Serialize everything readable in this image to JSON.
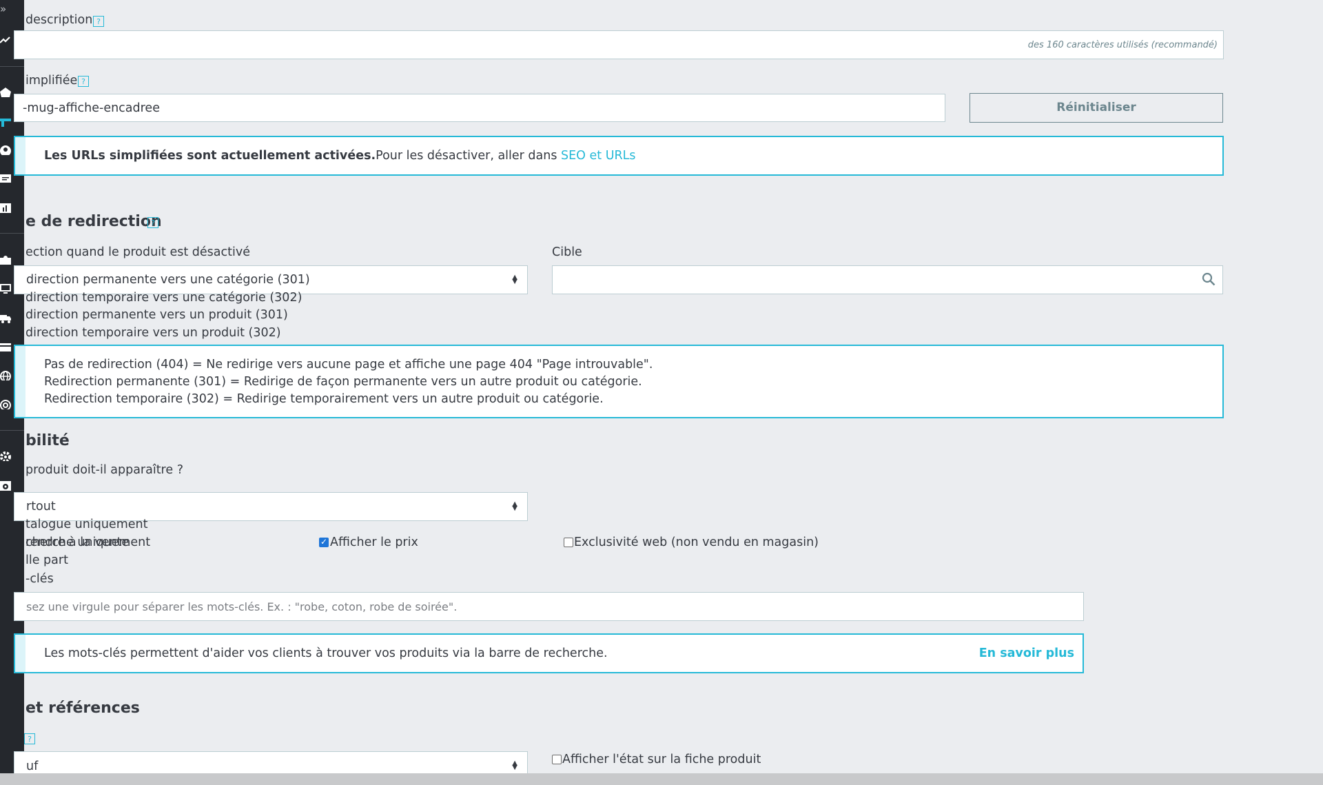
{
  "sidebar": {
    "icons": [
      "expand-icon",
      "stats-icon",
      "orders-icon",
      "catalog-icon",
      "customers-icon",
      "messages-icon",
      "reports-icon",
      "modules-icon",
      "design-icon",
      "shipping-icon",
      "payment-icon",
      "international-icon",
      "advanced-icon",
      "settings-icon",
      "config-icon"
    ],
    "expand_glyph": "»"
  },
  "meta_description": {
    "label": "description",
    "help": "?",
    "counter": "des 160 caractères utilisés (recommandé)"
  },
  "friendly_url": {
    "label": "implifiée",
    "help": "?",
    "value": "-mug-affiche-encadree",
    "reset_label": "Réinitialiser",
    "info_bold": "Les URLs simplifiées sont actuellement activées.",
    "info_text": "Pour les désactiver, aller dans ",
    "info_link": "SEO et URLs"
  },
  "redirection": {
    "title": "e de redirection",
    "help": "?",
    "when_label": "ection quand le produit est désactivé",
    "selected": "direction permanente vers une catégorie (301)",
    "options": [
      "direction temporaire vers une catégorie (302)",
      "direction permanente vers un produit (301)",
      "direction temporaire vers un produit (302)"
    ],
    "target_label": "Cible",
    "info_lines": [
      "Pas de redirection (404) = Ne redirige vers aucune page et affiche une page 404 \"Page introuvable\".",
      "Redirection permanente (301) = Redirige de façon permanente vers un autre produit ou catégorie.",
      "Redirection temporaire (302) = Redirige temporairement vers un autre produit ou catégorie."
    ]
  },
  "visibility": {
    "title": "bilité",
    "question": "produit doit-il apparaître ?",
    "selected": "rtout",
    "options": [
      "talogue uniquement",
      "cherche uniquement",
      "lle part"
    ],
    "overlap_text": "rendre à la vente",
    "show_price_label": "Afficher le prix",
    "show_price_checked": true,
    "web_only_label": "Exclusivité web (non vendu en magasin)",
    "web_only_checked": false
  },
  "tags": {
    "label": "-clés",
    "placeholder": "sez une virgule pour séparer les mots-clés. Ex. : \"robe, coton, robe de soirée\".",
    "info": "Les mots-clés permettent d'aider vos clients à trouver vos produits via la barre de recherche.",
    "learn_more": "En savoir plus"
  },
  "condition": {
    "title": "et références",
    "help": "?",
    "selected": "uf",
    "show_condition_label": "Afficher l'état sur la fiche produit",
    "show_condition_checked": false
  },
  "colors": {
    "accent": "#25b9d7",
    "sidebar": "#25282d",
    "background": "#ebedf0",
    "text": "#363a41"
  }
}
